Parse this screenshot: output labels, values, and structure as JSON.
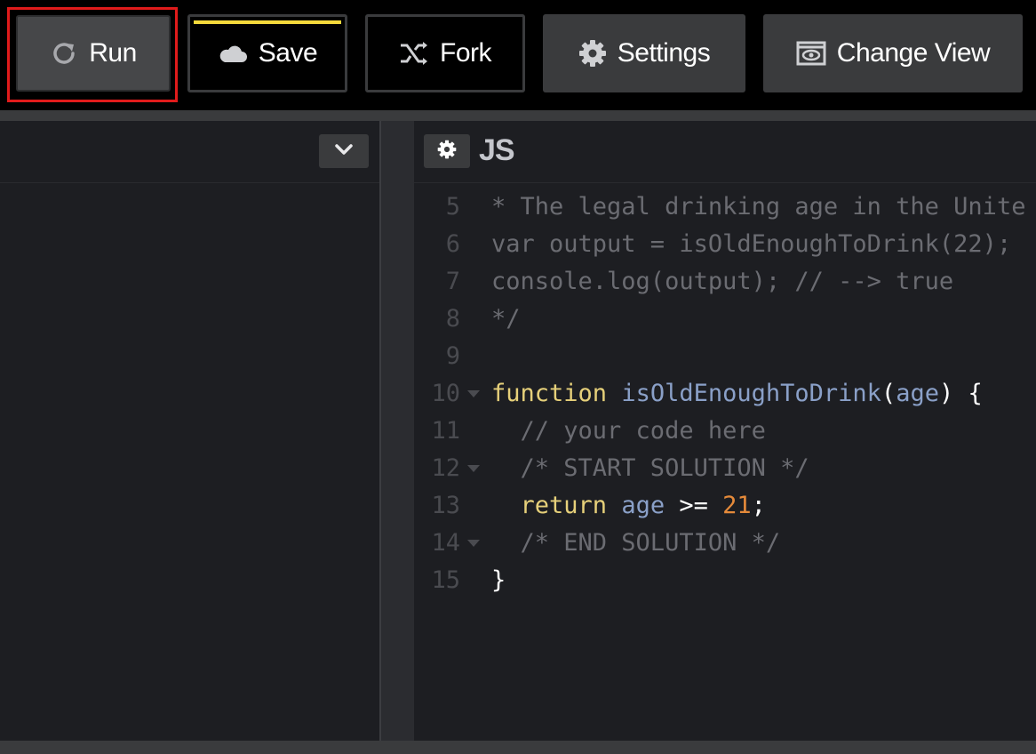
{
  "toolbar": {
    "run_label": "Run",
    "save_label": "Save",
    "fork_label": "Fork",
    "settings_label": "Settings",
    "change_view_label": "Change View"
  },
  "icons": {
    "run": "refresh-icon",
    "save": "cloud-icon",
    "fork": "fork-icon",
    "settings": "gear-icon",
    "change_view": "eye-window-icon",
    "collapse": "chevron-down-icon",
    "editor_settings": "gear-icon"
  },
  "colors": {
    "highlight": "#e01b1b",
    "save_accent": "#f5d93b",
    "keyword": "#e6d07a",
    "identifier": "#8aa0c8",
    "number": "#e58a3a",
    "comment": "#6b6c72"
  },
  "editor": {
    "language_label": "JS",
    "lines": [
      {
        "num": "5",
        "fold": false,
        "tokens": [
          {
            "t": "* The legal drinking age in the Unite",
            "c": "comment"
          }
        ]
      },
      {
        "num": "6",
        "fold": false,
        "tokens": [
          {
            "t": "var output = isOldEnoughToDrink(22);",
            "c": "comment"
          }
        ]
      },
      {
        "num": "7",
        "fold": false,
        "tokens": [
          {
            "t": "console.log(output); // --> true",
            "c": "comment"
          }
        ]
      },
      {
        "num": "8",
        "fold": false,
        "tokens": [
          {
            "t": "*/",
            "c": "comment"
          }
        ]
      },
      {
        "num": "9",
        "fold": false,
        "tokens": []
      },
      {
        "num": "10",
        "fold": true,
        "tokens": [
          {
            "t": "function",
            "c": "kw"
          },
          {
            "t": " ",
            "c": "punc"
          },
          {
            "t": "isOldEnoughToDrink",
            "c": "fn"
          },
          {
            "t": "(",
            "c": "punc"
          },
          {
            "t": "age",
            "c": "var"
          },
          {
            "t": ") {",
            "c": "punc"
          }
        ]
      },
      {
        "num": "11",
        "fold": false,
        "tokens": [
          {
            "t": "  // your code here",
            "c": "comment"
          }
        ]
      },
      {
        "num": "12",
        "fold": true,
        "tokens": [
          {
            "t": "  /* START SOLUTION */",
            "c": "comment"
          }
        ]
      },
      {
        "num": "13",
        "fold": false,
        "tokens": [
          {
            "t": "  ",
            "c": "punc"
          },
          {
            "t": "return",
            "c": "kw"
          },
          {
            "t": " ",
            "c": "punc"
          },
          {
            "t": "age",
            "c": "var"
          },
          {
            "t": " >= ",
            "c": "punc"
          },
          {
            "t": "21",
            "c": "num"
          },
          {
            "t": ";",
            "c": "punc"
          }
        ]
      },
      {
        "num": "14",
        "fold": true,
        "tokens": [
          {
            "t": "  /* END SOLUTION */",
            "c": "comment"
          }
        ]
      },
      {
        "num": "15",
        "fold": false,
        "tokens": [
          {
            "t": "}",
            "c": "punc"
          }
        ]
      }
    ]
  }
}
